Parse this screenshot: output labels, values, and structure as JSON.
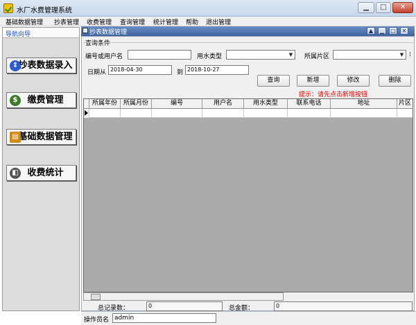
{
  "window": {
    "title": "水厂水费管理系统"
  },
  "menu": [
    "基础数据管理",
    "抄表管理",
    "收费管理",
    "查询管理",
    "统计管理",
    "帮助",
    "退出管理"
  ],
  "nav": {
    "header": "导航向导",
    "items": [
      {
        "label": "抄表数据录入",
        "icon": "meter-icon"
      },
      {
        "label": "缴费管理",
        "icon": "money-bag-icon"
      },
      {
        "label": "基础数据管理",
        "icon": "data-icon"
      },
      {
        "label": "收费统计",
        "icon": "stats-icon"
      }
    ]
  },
  "child": {
    "title": "抄表数据管理",
    "group_label": "查询条件",
    "labels": {
      "code_or_user": "编号或用户名",
      "water_type": "用水类型",
      "area": "所属片区",
      "date_from": "日期从",
      "to": "到"
    },
    "values": {
      "code_or_user": "",
      "water_type": "",
      "area": "",
      "date_from": "2018-04-30",
      "date_to": "2018-10-27"
    },
    "buttons": {
      "query": "查询",
      "add": "新增",
      "edit": "修改",
      "delete": "删除"
    },
    "hint": "提示：请先点击新增按钮",
    "grid_columns": [
      "所属年份",
      "所属月份",
      "编号",
      "用户名",
      "用水类型",
      "联系电话",
      "地址",
      "片区"
    ],
    "footer": {
      "record_count_label": "总记录数：",
      "record_count": "0",
      "total_amount_label": "总金额：",
      "total_amount": "0"
    }
  },
  "status": {
    "operator_label": "操作员名",
    "operator": "admin"
  },
  "colors": {
    "hint": "#e00000",
    "nav_header": "#1c4fb5",
    "child_title_bg": "#3d63a0"
  }
}
